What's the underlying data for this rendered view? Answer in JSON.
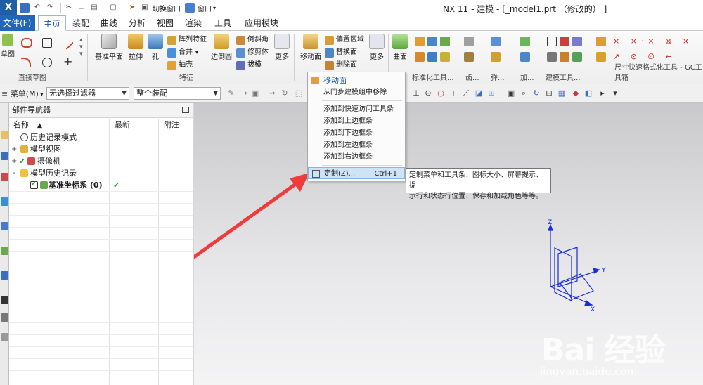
{
  "window": {
    "app_logo": "X",
    "title": "NX 11 - 建模 - [_model1.prt （修改的） ]"
  },
  "quick_access": {
    "switch_window": "切换窗口",
    "window": "窗口"
  },
  "tabs": {
    "file": "文件(F)",
    "items": [
      "主页",
      "装配",
      "曲线",
      "分析",
      "视图",
      "渲染",
      "工具",
      "应用模块"
    ],
    "active_index": 0
  },
  "ribbon": {
    "sketch_label": "草图",
    "direct_sketch_group": "直接草图",
    "datum_plane": "基准平面",
    "extrude": "拉伸",
    "hole": "孔",
    "pattern_feature": "阵列特征",
    "unite": "合并",
    "shell": "抽壳",
    "edge_blend": "边倒圆",
    "chamfer": "倒斜角",
    "trim_body": "修剪体",
    "draft": "拔模",
    "more_1": "更多",
    "feature_group": "特征",
    "move_face": "移动面",
    "offset_region": "偏置区域",
    "replace_face": "替换面",
    "delete_face": "删除面",
    "more_2": "更多",
    "surface": "曲面",
    "std_tools_group": "标准化工具...",
    "gear_group": "齿...",
    "spring_group": "弹...",
    "add_group": "加...",
    "modeling_tools_group": "建模工具...",
    "dim_tools_group": "尺寸快速格式化工具 - GC工具箱"
  },
  "selection_bar": {
    "menu": "菜单(M)",
    "filter": "无选择过滤器",
    "scope": "整个装配"
  },
  "navigator": {
    "title": "部件导航器",
    "columns": [
      "名称",
      "最新",
      "附注"
    ],
    "rows": [
      {
        "label": "历史记录模式",
        "indent": 1,
        "expander": "",
        "checked": false,
        "latest": ""
      },
      {
        "label": "模型视图",
        "indent": 0,
        "expander": "+",
        "checked": false,
        "latest": ""
      },
      {
        "label": "摄像机",
        "indent": 0,
        "expander": "+",
        "checked": true,
        "latest": ""
      },
      {
        "label": "模型历史记录",
        "indent": 0,
        "expander": "-",
        "checked": false,
        "latest": ""
      },
      {
        "label": "基准坐标系 (0)",
        "indent": 2,
        "expander": "",
        "checked": true,
        "latest": "✔"
      }
    ]
  },
  "context_menu": {
    "title": "移动面",
    "items": [
      "从同步建模组中移除",
      "添加到快速访问工具条",
      "添加到上边框条",
      "添加到下边框条",
      "添加到左边框条",
      "添加到右边框条"
    ],
    "customize": "定制(Z)...",
    "customize_shortcut": "Ctrl+1"
  },
  "tooltip": {
    "line1": "定制菜单和工具条、图标大小、屏幕提示、提",
    "line2": "示行和状态行位置、保存和加载角色等等。"
  },
  "triad": {
    "z_label": "Z",
    "y_label": "Y",
    "x_label": "X"
  },
  "watermark": {
    "brand": "Bai 经验",
    "url": "jingyan.baidu.com"
  },
  "colors": {
    "accent": "#2366b7",
    "arrow": "#ee3b3b",
    "triad": "#1a2bd8",
    "check": "#2a9a2a"
  }
}
